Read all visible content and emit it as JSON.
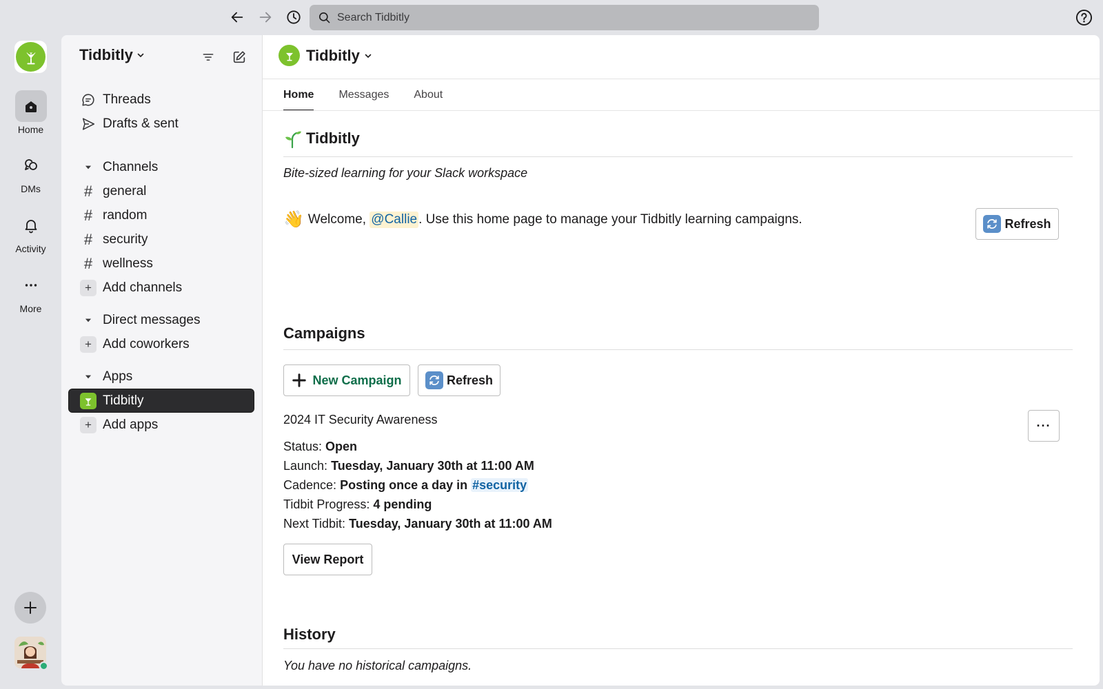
{
  "topbar": {
    "search_placeholder": "Search Tidbitly"
  },
  "rail": {
    "items": [
      {
        "label": "Home",
        "icon": "home-icon"
      },
      {
        "label": "DMs",
        "icon": "dms-icon"
      },
      {
        "label": "Activity",
        "icon": "bell-icon"
      },
      {
        "label": "More",
        "icon": "more-icon"
      }
    ]
  },
  "sidebar": {
    "workspace_name": "Tidbitly",
    "nav": [
      {
        "label": "Threads",
        "icon": "threads-icon"
      },
      {
        "label": "Drafts & sent",
        "icon": "send-icon"
      }
    ],
    "channels_header": "Channels",
    "channels": [
      "general",
      "random",
      "security",
      "wellness"
    ],
    "add_channels": "Add channels",
    "dms_header": "Direct messages",
    "add_coworkers": "Add coworkers",
    "apps_header": "Apps",
    "apps": [
      "Tidbitly"
    ],
    "add_apps": "Add apps"
  },
  "main": {
    "title": "Tidbitly",
    "tabs": [
      "Home",
      "Messages",
      "About"
    ],
    "active_tab": "Home",
    "heading": "Tidbitly",
    "tagline": "Bite-sized learning for your Slack workspace",
    "welcome_prefix": "Welcome,",
    "welcome_mention": "@Callie",
    "welcome_suffix": ". Use this home page to manage your Tidbitly learning campaigns.",
    "refresh_label": "Refresh",
    "campaigns_heading": "Campaigns",
    "new_campaign_label": "New Campaign",
    "campaign": {
      "name": "2024 IT Security Awareness",
      "status_label": "Status:",
      "status_value": "Open",
      "launch_label": "Launch:",
      "launch_value": "Tuesday, January 30th at 11:00 AM",
      "cadence_label": "Cadence:",
      "cadence_value": "Posting once a day in",
      "cadence_channel": "#security",
      "progress_label": "Tidbit Progress:",
      "progress_value": "4 pending",
      "next_label": "Next Tidbit:",
      "next_value": "Tuesday, January 30th at 11:00 AM",
      "more_label": "···",
      "report_label": "View Report"
    },
    "history_heading": "History",
    "history_empty": "You have no historical campaigns."
  },
  "colors": {
    "brand_green": "#7dc22d",
    "link_blue": "#1264a3",
    "button_green_text": "#0f6e4a",
    "selected_bg": "#2c2c2e"
  }
}
